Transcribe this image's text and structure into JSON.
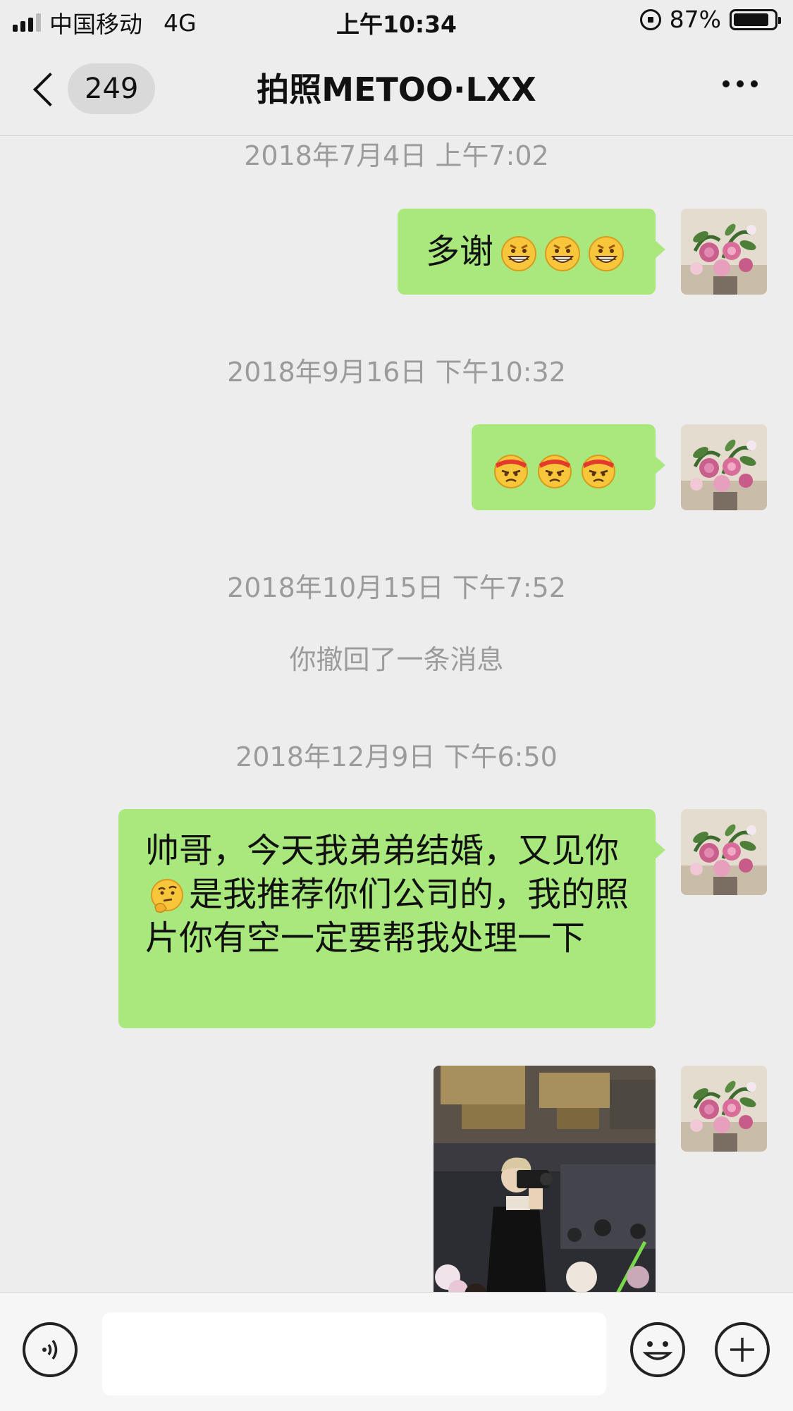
{
  "status_bar": {
    "carrier": "中国移动",
    "network": "4G",
    "time": "上午10:34",
    "battery": "87%",
    "battery_level": 0.87
  },
  "nav": {
    "unread_count": "249",
    "title": "拍照METOO·LXX"
  },
  "messages": [
    {
      "type": "timestamp",
      "text": "2018年7月4日 上午7:02"
    },
    {
      "type": "text",
      "from": "me",
      "text": "多谢",
      "emoji": [
        "grin-icon",
        "grin-icon",
        "grin-icon"
      ]
    },
    {
      "type": "timestamp",
      "text": "2018年9月16日 下午10:32"
    },
    {
      "type": "text",
      "from": "me",
      "text": "",
      "emoji": [
        "angry-headband-icon",
        "angry-headband-icon",
        "angry-headband-icon"
      ]
    },
    {
      "type": "timestamp",
      "text": "2018年10月15日 下午7:52"
    },
    {
      "type": "system",
      "text": "你撤回了一条消息"
    },
    {
      "type": "timestamp",
      "text": "2018年12月9日 下午6:50"
    },
    {
      "type": "text",
      "from": "me",
      "text_before_emoji": "帅哥，今天我弟弟结婚，又见你",
      "emoji": [
        "thinking-icon"
      ],
      "text_after_emoji": "是我推荐你们公司的，我的照片你有空一定要帮我处理一下"
    },
    {
      "type": "image",
      "from": "me",
      "subject": "photographer-photo"
    }
  ],
  "input_bar": {
    "value": "",
    "left_icon": "voice-icon",
    "emoji_icon": "emoji-icon",
    "plus_icon": "plus-icon"
  },
  "colors": {
    "bubble": "#a9e87c",
    "background": "#ededed",
    "timestamp": "#9b9b9b"
  }
}
